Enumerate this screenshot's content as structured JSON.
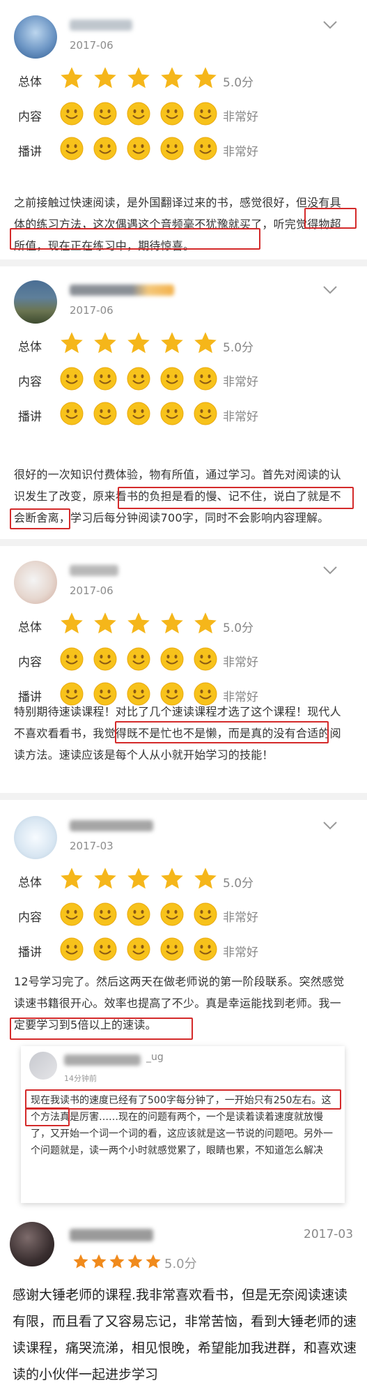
{
  "labels": {
    "overall": "总体",
    "content": "内容",
    "narration": "播讲"
  },
  "reviews": [
    {
      "date": "2017-06",
      "overall": "5.0分",
      "content": "非常好",
      "narration": "非常好",
      "text": "之前接触过快速阅读，是外国翻译过来的书，感觉很好，但没有具体的练习方法，这次偶遇这个音频毫不犹豫就买了，听完觉得物超所值，现在正在练习中，期待惊喜。"
    },
    {
      "date": "2017-06",
      "overall": "5.0分",
      "content": "非常好",
      "narration": "非常好",
      "text": "很好的一次知识付费体验，物有所值，通过学习。首先对阅读的认识发生了改变，原来看书的负担是看的慢、记不住，说白了就是不会断舍离，学习后每分钟阅读700字，同时不会影响内容理解。"
    },
    {
      "date": "2017-06",
      "overall": "5.0分",
      "content": "非常好",
      "narration": "非常好",
      "text": "特别期待速读课程！对比了几个速读课程才选了这个课程！现代人不喜欢看看书，我觉得既不是忙也不是懒，而是真的没有合适的阅读方法。速读应该是每个人从小就开始学习的技能！"
    },
    {
      "date": "2017-03",
      "overall": "5.0分",
      "content": "非常好",
      "narration": "非常好",
      "text": "12号学习完了。然后这两天在做老师说的第一阶段联系。突然感觉读速书籍很开心。效率也提高了不少。真是幸运能找到老师。我一定要学习到5倍以上的速读。"
    }
  ],
  "comment": {
    "name_tail": "_ug",
    "time": "14分钟前",
    "text": "现在我读书的速度已经有了500字每分钟了，一开始只有250左右。这个方法真是厉害……现在的问题有两个，一个是读着读着速度就放慢了，又开始一个词一个词的看，这应该就是这一节说的问题吧。另外一个问题就是，读一两个小时就感觉累了，眼睛也累，不知道怎么解决"
  },
  "last_review": {
    "date": "2017-03",
    "rating": "5.0分",
    "text": "感谢大锤老师的课程.我非常喜欢看书，但是无奈阅读速读有限，而且看了又容易忘记，非常苦恼，看到大锤老师的速读课程，痛哭流涕，相见恨晚，希望能加我进群，和喜欢速读的小伙伴一起进步学习"
  },
  "colors": {
    "star": "#f5b61a",
    "face": "#f7c21b",
    "highlight": "#d42a2a",
    "last_star": "#f08a1c"
  },
  "icons": {
    "chevron": "chevron-down-icon",
    "star": "star-icon",
    "face": "smiley-icon"
  }
}
